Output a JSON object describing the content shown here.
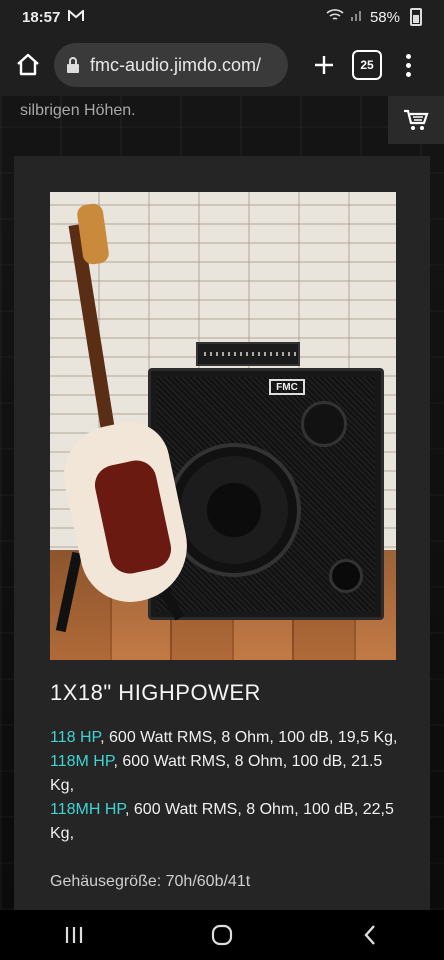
{
  "status": {
    "time": "18:57",
    "battery": "58%"
  },
  "browser": {
    "url": "fmc-audio.jimdo.com/",
    "tab_count": "25"
  },
  "page": {
    "top_text": "silbrigen Höhen.",
    "product": {
      "title": "1X18\" HIGHPOWER",
      "specs": [
        {
          "model": "118 HP",
          "text": ", 600 Watt RMS, 8 Ohm, 100 dB, 19,5 Kg,"
        },
        {
          "model": "118M HP",
          "text": ", 600 Watt RMS, 8 Ohm, 100 dB, 21.5 Kg,"
        },
        {
          "model": "118MH HP",
          "text": ", 600 Watt RMS, 8 Ohm, 100 dB, 22,5 Kg,"
        }
      ],
      "cut_text": "Gehäusegröße: 70h/60b/41t"
    }
  }
}
